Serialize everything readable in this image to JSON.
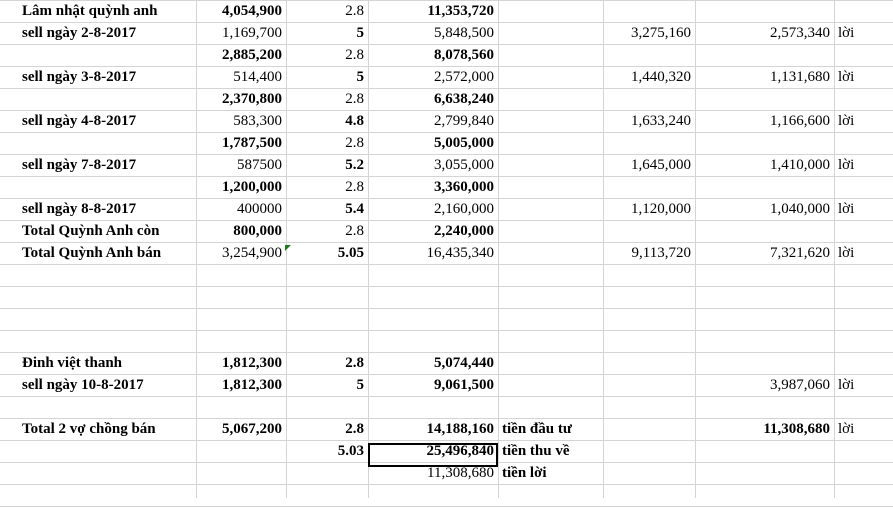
{
  "sheet": {
    "rows": [
      {
        "a": "Lâm nhật quỳnh anh",
        "b": "4,054,900",
        "c": "2.8",
        "d": "11,353,720",
        "e": "",
        "f": "",
        "g": "",
        "h": "",
        "bold": {
          "a": true,
          "b": true,
          "c": false,
          "d": true,
          "f": false,
          "g": false
        }
      },
      {
        "a": "sell  ngày 2-8-2017",
        "b": "1,169,700",
        "c": "5",
        "d": "5,848,500",
        "e": "",
        "f": "3,275,160",
        "g": "2,573,340",
        "h": "lời",
        "bold": {
          "a": true,
          "b": false,
          "c": true,
          "d": false,
          "f": false,
          "g": false
        }
      },
      {
        "a": "",
        "b": "2,885,200",
        "c": "2.8",
        "d": "8,078,560",
        "e": "",
        "f": "",
        "g": "",
        "h": "",
        "bold": {
          "a": false,
          "b": true,
          "c": false,
          "d": true,
          "f": false,
          "g": false
        }
      },
      {
        "a": "sell ngày 3-8-2017",
        "b": "514,400",
        "c": "5",
        "d": "2,572,000",
        "e": "",
        "f": "1,440,320",
        "g": "1,131,680",
        "h": "lời",
        "bold": {
          "a": true,
          "b": false,
          "c": true,
          "d": false,
          "f": false,
          "g": false
        }
      },
      {
        "a": "",
        "b": "2,370,800",
        "c": "2.8",
        "d": "6,638,240",
        "e": "",
        "f": "",
        "g": "",
        "h": "",
        "bold": {
          "a": false,
          "b": true,
          "c": false,
          "d": true,
          "f": false,
          "g": false
        }
      },
      {
        "a": "sell ngày 4-8-2017",
        "b": "583,300",
        "c": "4.8",
        "d": "2,799,840",
        "e": "",
        "f": "1,633,240",
        "g": "1,166,600",
        "h": "lời",
        "bold": {
          "a": true,
          "b": false,
          "c": true,
          "d": false,
          "f": false,
          "g": false
        }
      },
      {
        "a": "",
        "b": "1,787,500",
        "c": "2.8",
        "d": "5,005,000",
        "e": "",
        "f": "",
        "g": "",
        "h": "",
        "bold": {
          "a": false,
          "b": true,
          "c": false,
          "d": true,
          "f": false,
          "g": false
        }
      },
      {
        "a": "sell ngày 7-8-2017",
        "b": "587500",
        "c": "5.2",
        "d": "3,055,000",
        "e": "",
        "f": "1,645,000",
        "g": "1,410,000",
        "h": "lời",
        "bold": {
          "a": true,
          "b": false,
          "c": true,
          "d": false,
          "f": false,
          "g": false
        }
      },
      {
        "a": "",
        "b": "1,200,000",
        "c": "2.8",
        "d": "3,360,000",
        "e": "",
        "f": "",
        "g": "",
        "h": "",
        "bold": {
          "a": false,
          "b": true,
          "c": false,
          "d": true,
          "f": false,
          "g": false
        }
      },
      {
        "a": "sell ngày 8-8-2017",
        "b": "400000",
        "c": "5.4",
        "d": "2,160,000",
        "e": "",
        "f": "1,120,000",
        "g": "1,040,000",
        "h": "lời",
        "bold": {
          "a": true,
          "b": false,
          "c": true,
          "d": false,
          "f": false,
          "g": false
        }
      },
      {
        "a": "Total Quỳnh Anh còn",
        "b": "800,000",
        "c": "2.8",
        "d": "2,240,000",
        "e": "",
        "f": "",
        "g": "",
        "h": "",
        "bold": {
          "a": true,
          "b": true,
          "c": false,
          "d": true,
          "f": false,
          "g": false
        }
      },
      {
        "a": "Total Quỳnh Anh bán",
        "b": "3,254,900",
        "c": "5.05",
        "d": "16,435,340",
        "e": "",
        "f": "9,113,720",
        "g": "7,321,620",
        "h": "lời",
        "bold": {
          "a": true,
          "b": false,
          "c": true,
          "d": false,
          "f": false,
          "g": false
        }
      },
      {
        "a": "",
        "b": "",
        "c": "",
        "d": "",
        "e": "",
        "f": "",
        "g": "",
        "h": "",
        "bold": {}
      },
      {
        "a": "",
        "b": "",
        "c": "",
        "d": "",
        "e": "",
        "f": "",
        "g": "",
        "h": "",
        "bold": {}
      },
      {
        "a": "",
        "b": "",
        "c": "",
        "d": "",
        "e": "",
        "f": "",
        "g": "",
        "h": "",
        "bold": {}
      },
      {
        "a": "",
        "b": "",
        "c": "",
        "d": "",
        "e": "",
        "f": "",
        "g": "",
        "h": "",
        "bold": {}
      },
      {
        "a": "Đinh việt thanh",
        "b": "1,812,300",
        "c": "2.8",
        "d": "5,074,440",
        "e": "",
        "f": "",
        "g": "",
        "h": "",
        "bold": {
          "a": true,
          "b": true,
          "c": true,
          "d": true,
          "f": false,
          "g": false
        }
      },
      {
        "a": "sell ngày 10-8-2017",
        "b": "1,812,300",
        "c": "5",
        "d": "9,061,500",
        "e": "",
        "f": "",
        "g": "3,987,060",
        "h": "lời",
        "bold": {
          "a": true,
          "b": true,
          "c": true,
          "d": true,
          "f": false,
          "g": false
        }
      },
      {
        "a": "",
        "b": "",
        "c": "",
        "d": "",
        "e": "",
        "f": "",
        "g": "",
        "h": "",
        "bold": {}
      },
      {
        "a": "Total 2 vợ chồng bán",
        "b": "5,067,200",
        "c": "2.8",
        "d": "14,188,160",
        "e": "tiền đầu tư",
        "f": "",
        "g": "11,308,680",
        "h": "lời",
        "bold": {
          "a": true,
          "b": true,
          "c": true,
          "d": true,
          "e": true,
          "f": false,
          "g": true
        }
      },
      {
        "a": "",
        "b": "",
        "c": "5.03",
        "d": "25,496,840",
        "e": "tiền thu về",
        "f": "",
        "g": "",
        "h": "",
        "bold": {
          "a": false,
          "b": false,
          "c": true,
          "d": true,
          "e": true,
          "f": false,
          "g": false
        }
      },
      {
        "a": "",
        "b": "",
        "c": "",
        "d": "11,308,680",
        "e": "tiền lời",
        "f": "",
        "g": "",
        "h": "",
        "bold": {
          "a": false,
          "b": false,
          "c": false,
          "d": false,
          "e": true,
          "f": false,
          "g": false
        }
      }
    ]
  }
}
